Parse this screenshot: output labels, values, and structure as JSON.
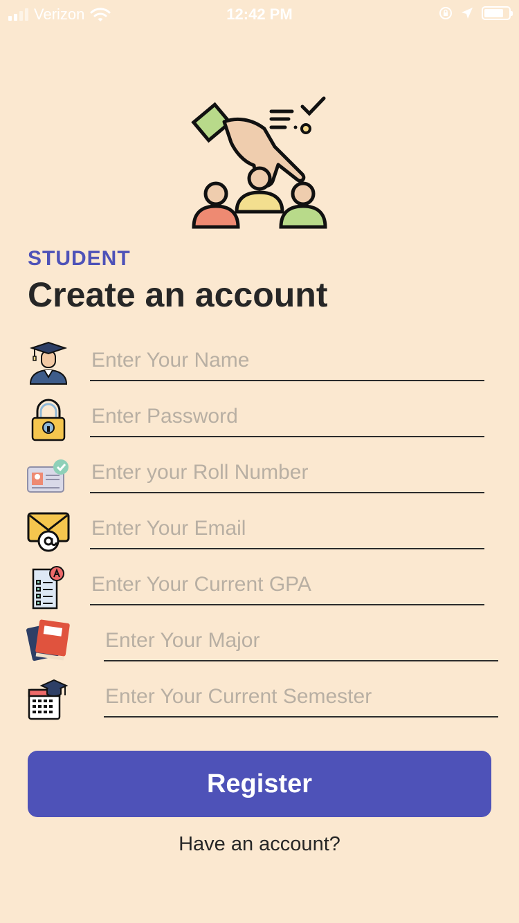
{
  "status_bar": {
    "carrier": "Verizon",
    "time": "12:42 PM"
  },
  "header": {
    "subtitle": "STUDENT",
    "title": "Create an account"
  },
  "form": {
    "fields": [
      {
        "placeholder": "Enter Your Name",
        "value": "",
        "icon": "graduate-icon"
      },
      {
        "placeholder": "Enter Password",
        "value": "",
        "icon": "padlock-icon"
      },
      {
        "placeholder": "Enter your Roll Number",
        "value": "",
        "icon": "id-card-icon"
      },
      {
        "placeholder": "Enter Your Email",
        "value": "",
        "icon": "email-icon"
      },
      {
        "placeholder": "Enter Your Current GPA",
        "value": "",
        "icon": "grade-report-icon"
      },
      {
        "placeholder": "Enter Your Major",
        "value": "",
        "icon": "books-icon"
      },
      {
        "placeholder": "Enter Your Current Semester",
        "value": "",
        "icon": "calendar-cap-icon"
      }
    ],
    "register_label": "Register",
    "login_link": "Have an account?"
  },
  "colors": {
    "background": "#FBE8D0",
    "accent": "#4E52B8"
  }
}
